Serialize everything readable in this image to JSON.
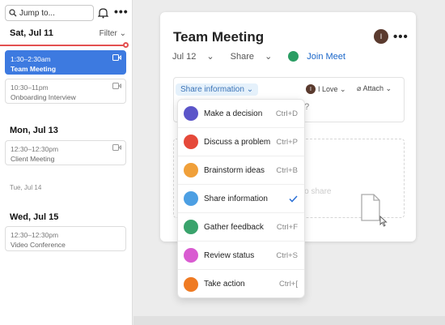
{
  "sidebar": {
    "search_placeholder": "Jump to...",
    "day": "Sat, Jul 11",
    "filter_label": "Filter",
    "events_jul11": [
      {
        "time": "1:30–2:30am",
        "name": "Team Meeting",
        "selected": true
      },
      {
        "time": "10:30–11pm",
        "name": "Onboarding Interview",
        "selected": false
      }
    ],
    "day_jul13": "Mon, Jul 13",
    "events_jul13": [
      {
        "time": "12:30–12:30pm",
        "name": "Client Meeting"
      }
    ],
    "day_jul14": "Tue, Jul 14",
    "day_jul15": "Wed, Jul 15",
    "events_jul15": [
      {
        "time": "12:30–12:30pm",
        "name": "Video Conference"
      }
    ]
  },
  "card": {
    "title": "Team Meeting",
    "avatar_initial": "I",
    "date": "Jul 12",
    "share": "Share",
    "meet": "Join Meet",
    "composer": {
      "share_chip": "Share information",
      "love_initial": "I",
      "love_label": "I Love",
      "attach_label": "Attach",
      "placeholder_fragment": "e?"
    },
    "drop_text": "e to share"
  },
  "menu": {
    "items": [
      {
        "label": "Make a decision",
        "shortcut": "Ctrl+D",
        "color": "#5b55c9"
      },
      {
        "label": "Discuss a problem",
        "shortcut": "Ctrl+P",
        "color": "#e5493a"
      },
      {
        "label": "Brainstorm ideas",
        "shortcut": "Ctrl+B",
        "color": "#f0a03a"
      },
      {
        "label": "Share information",
        "shortcut": "",
        "color": "#4c9fe3",
        "checked": true
      },
      {
        "label": "Gather feedback",
        "shortcut": "Ctrl+F",
        "color": "#3aa36c"
      },
      {
        "label": "Review status",
        "shortcut": "Ctrl+S",
        "color": "#d95bd1"
      },
      {
        "label": "Take action",
        "shortcut": "Ctrl+[",
        "color": "#ef7a22"
      }
    ]
  }
}
